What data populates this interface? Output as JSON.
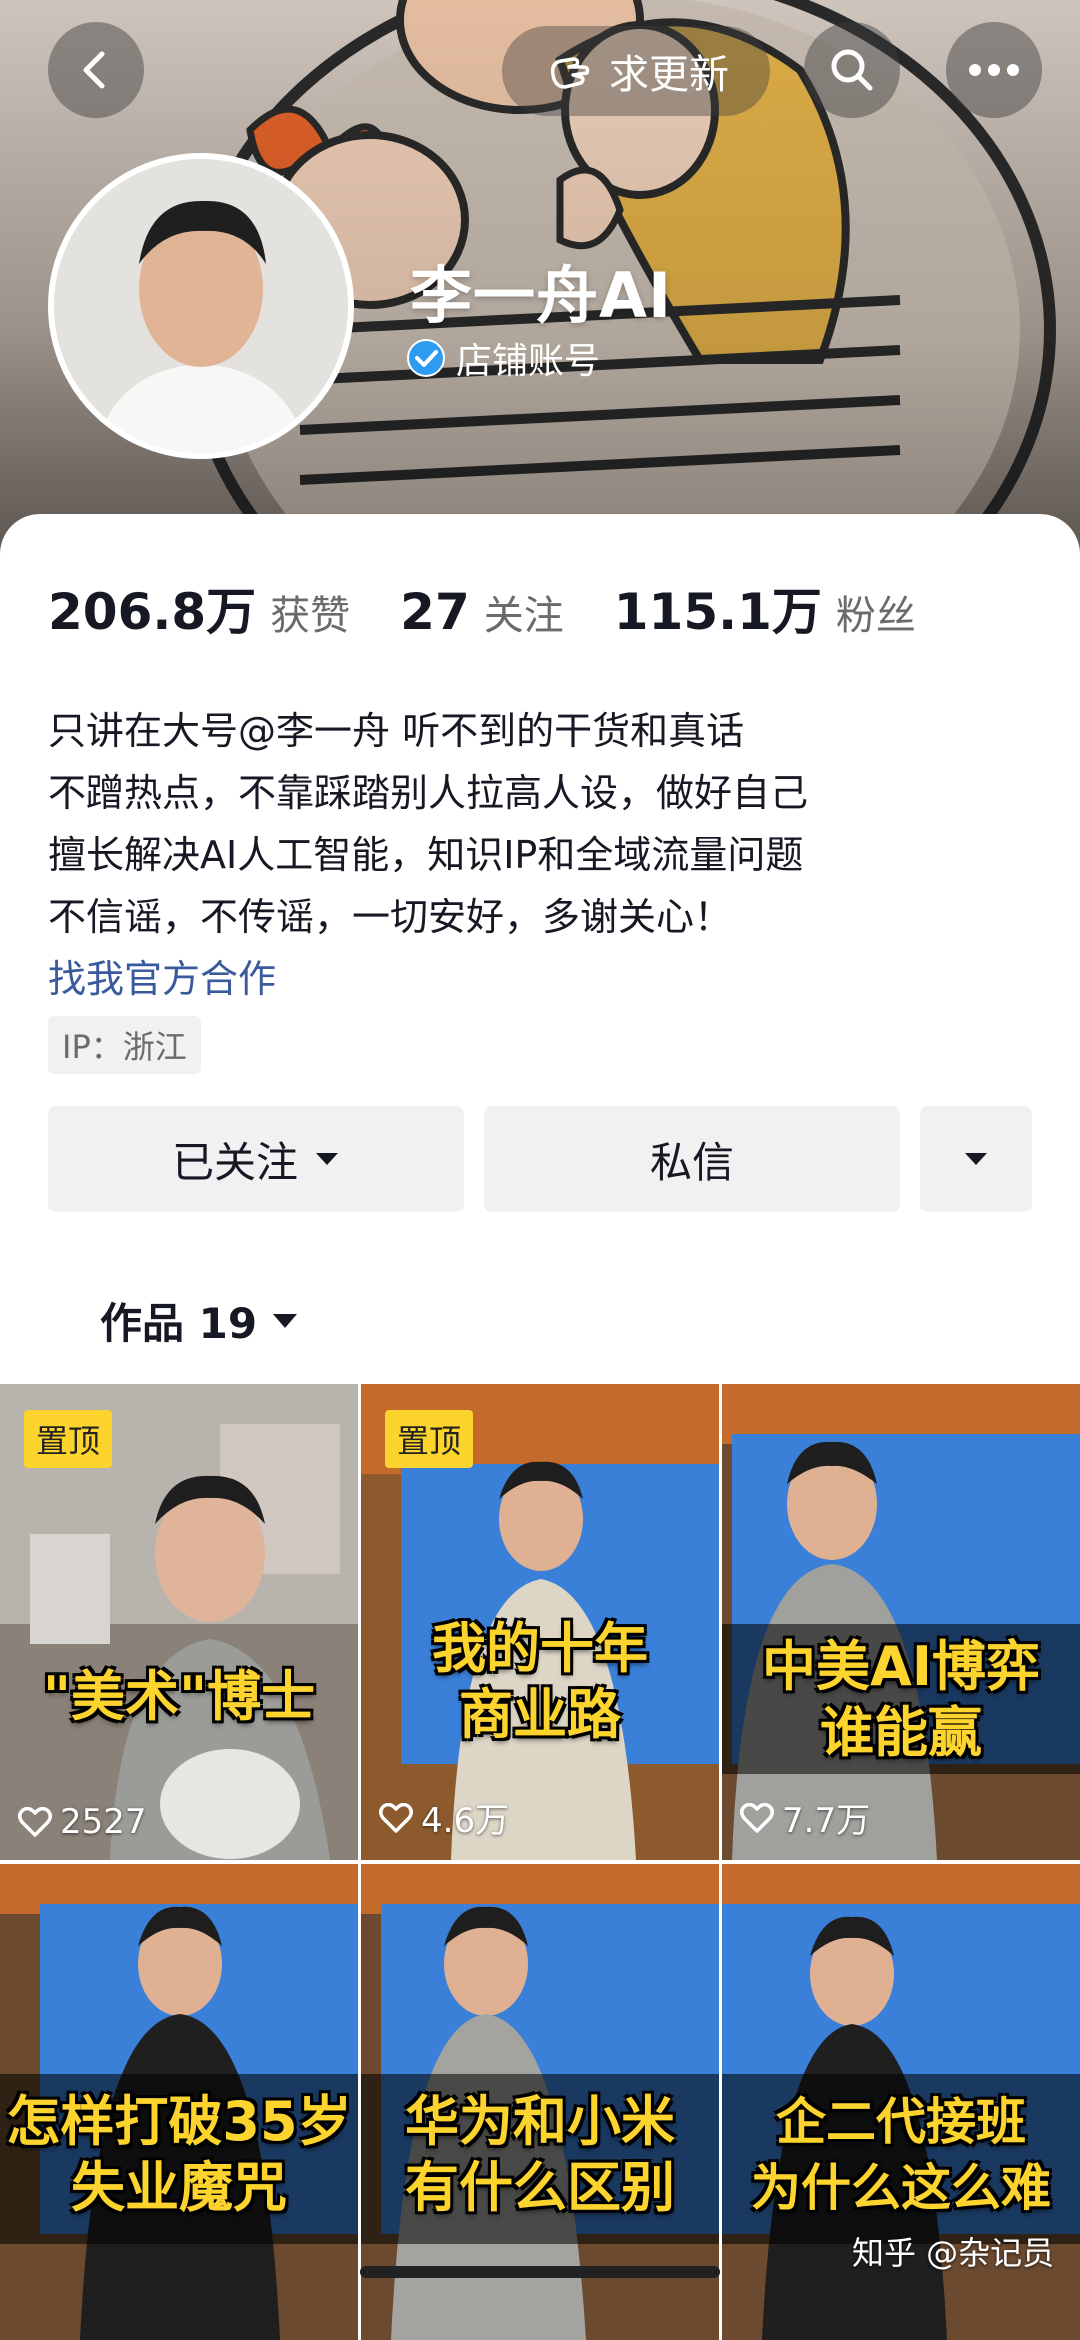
{
  "header": {
    "update_label": "求更新",
    "icons": [
      "back-arrow-icon",
      "hand-wave-icon",
      "search-icon",
      "more-dots-icon"
    ]
  },
  "profile": {
    "name": "李一舟AI",
    "badge_label": "店铺账号",
    "badge_color": "#2d9bf0"
  },
  "stats": [
    {
      "value": "206.8万",
      "label": "获赞"
    },
    {
      "value": "27",
      "label": "关注"
    },
    {
      "value": "115.1万",
      "label": "粉丝"
    }
  ],
  "bio": {
    "lines": [
      "只讲在大号@李一舟  听不到的干货和真话",
      "不蹭热点，不靠踩踏别人拉高人设，做好自己",
      "擅长解决AI人工智能，知识IP和全域流量问题",
      "不信谣，不传谣，一切安好，多谢关心！"
    ],
    "link": "找我官方合作",
    "ip": "IP：浙江"
  },
  "actions": {
    "follow_label": "已关注",
    "message_label": "私信"
  },
  "tabs": {
    "works_label": "作品 19"
  },
  "videos": [
    {
      "pinned": true,
      "pin_label": "置顶",
      "caption_lines": [
        "\"美术\"博士"
      ],
      "likes": "2527"
    },
    {
      "pinned": true,
      "pin_label": "置顶",
      "caption_lines": [
        "我的十年",
        "商业路"
      ],
      "likes": "4.6万"
    },
    {
      "pinned": false,
      "pin_label": "",
      "caption_lines": [
        "中美AI博弈",
        "谁能赢"
      ],
      "likes": "7.7万"
    },
    {
      "pinned": false,
      "pin_label": "",
      "caption_lines": [
        "怎样打破35岁",
        "失业魔咒"
      ],
      "likes": ""
    },
    {
      "pinned": false,
      "pin_label": "",
      "caption_lines": [
        "华为和小米",
        "有什么区别"
      ],
      "likes": ""
    },
    {
      "pinned": false,
      "pin_label": "",
      "caption_lines": [
        "企二代接班",
        "为什么这么难"
      ],
      "likes": ""
    }
  ],
  "watermark": "知乎 @杂记员",
  "colors": {
    "caption_yellow": "#fcd42d",
    "link_blue": "#3a5a9c",
    "button_gray": "#f1f1f2"
  }
}
